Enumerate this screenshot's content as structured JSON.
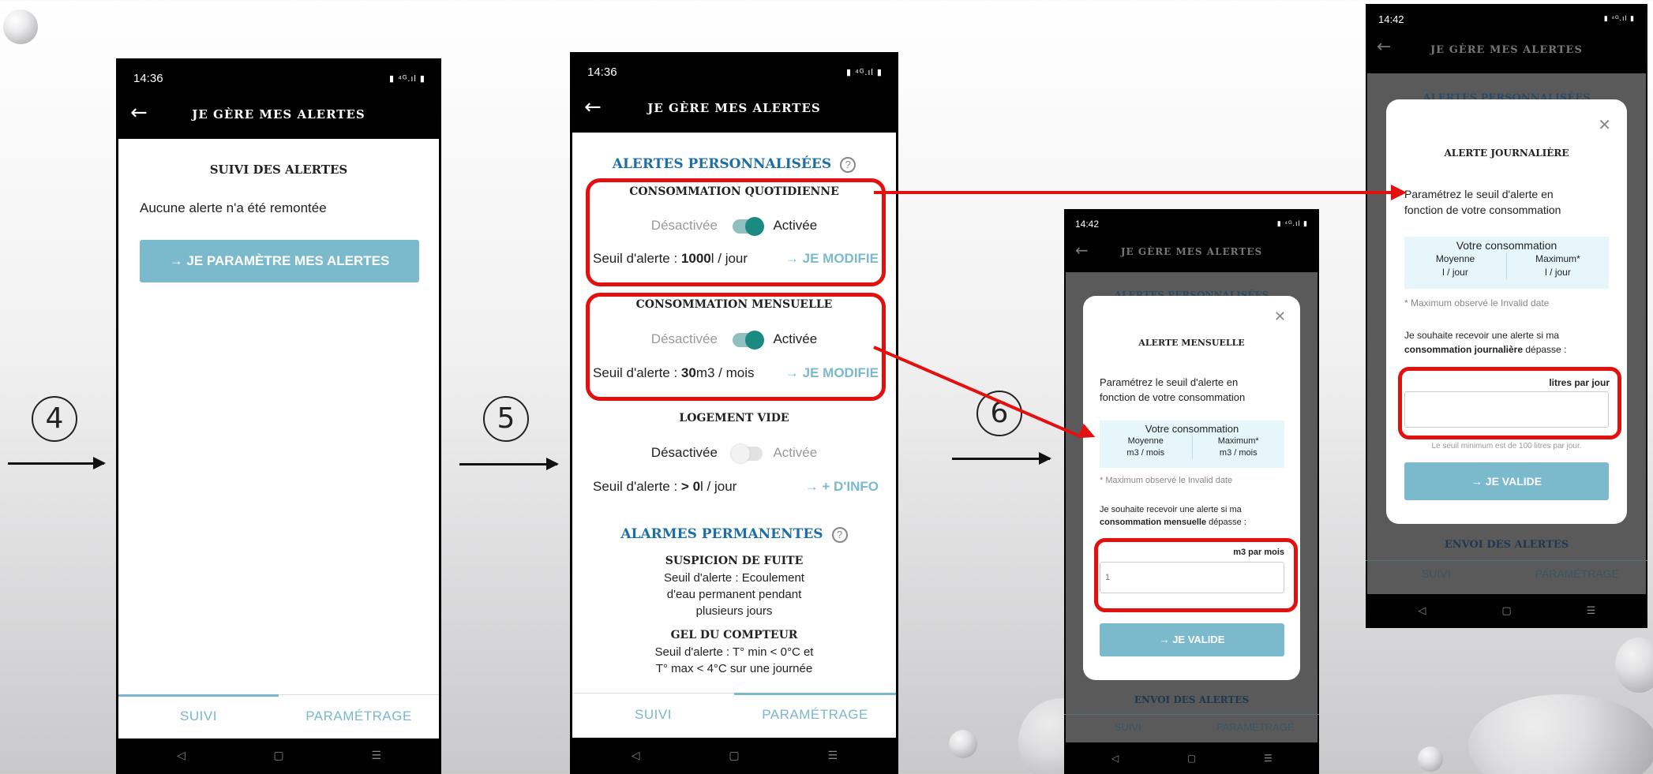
{
  "steps": {
    "s4": "4",
    "s5": "5",
    "s6": "6"
  },
  "status": {
    "time1": "14:36",
    "time2": "14:36",
    "time3": "14:42",
    "time4": "14:42",
    "icons": "▮ ⁴ᴳ.ıl ▮"
  },
  "header": {
    "title": "JE GÈRE MES ALERTES",
    "back": "←"
  },
  "screen4": {
    "heading": "SUIVI DES ALERTES",
    "empty": "Aucune alerte n'a été remontée",
    "button": "→ JE PARAMÈTRE MES ALERTES"
  },
  "tabs": {
    "suivi": "SUIVI",
    "param": "PARAMÉTRAGE"
  },
  "screen5": {
    "section1": "ALERTES PERSONNALISÉES",
    "help": "?",
    "daily": {
      "title": "CONSOMMATION QUOTIDIENNE",
      "off": "Désactivée",
      "on": "Activée",
      "prefix": "Seuil d'alerte : ",
      "value": "1000",
      "unit": "l / jour",
      "link": "→ JE MODIFIE"
    },
    "monthly": {
      "title": "CONSOMMATION MENSUELLE",
      "off": "Désactivée",
      "on": "Activée",
      "prefix": "Seuil d'alerte : ",
      "value": "30",
      "unit": "m3 / mois",
      "link": "→ JE MODIFIE"
    },
    "vacant": {
      "title": "LOGEMENT VIDE",
      "off": "Désactivée",
      "on": "Activée",
      "prefix": "Seuil d'alerte : ",
      "value": "> 0",
      "unit": "l / jour",
      "link": "→ + D'INFO"
    },
    "section2": "ALARMES PERMANENTES",
    "leak": {
      "title": "SUSPICION DE FUITE",
      "l1": "Seuil d'alerte : Ecoulement",
      "l2": "d'eau permanent pendant",
      "l3": "plusieurs jours"
    },
    "frost": {
      "title": "GEL DU COMPTEUR",
      "l1": "Seuil d'alerte : T° min < 0°C et",
      "l2": "T° max < 4°C sur une journée"
    }
  },
  "modal_monthly": {
    "bg_section": "ALERTES PERSONNALISÉES",
    "close": "✕",
    "title": "ALERTE MENSUELLE",
    "intro1": "Paramétrez le seuil d'alerte en",
    "intro2": "fonction de votre consommation",
    "cons_title": "Votre consommation",
    "avg_label": "Moyenne",
    "avg_unit": "m3 / mois",
    "max_label": "Maximum*",
    "max_unit": "m3 / mois",
    "footnote": "* Maximum observé le Invalid date",
    "wish1": "Je souhaite recevoir une alerte si ma",
    "wish2a": "consommation mensuelle",
    "wish2b": " dépasse :",
    "unit_label": "m3 par mois",
    "placeholder": "1",
    "button": "→ JE VALIDE",
    "bottom_title": "ENVOI DES ALERTES",
    "tab1": "SUIVI",
    "tab2": "PARAMÉTRAGE"
  },
  "modal_daily": {
    "bg_section": "ALERTES PERSONNALISÉES",
    "close": "✕",
    "title": "ALERTE JOURNALIÈRE",
    "intro1": "Paramétrez le seuil d'alerte en",
    "intro2": "fonction de votre consommation",
    "cons_title": "Votre consommation",
    "avg_label": "Moyenne",
    "avg_unit": "l / jour",
    "max_label": "Maximum*",
    "max_unit": "l / jour",
    "footnote": "* Maximum observé le Invalid date",
    "wish1": "Je souhaite recevoir une alerte si ma",
    "wish2a": "consommation journalière",
    "wish2b": " dépasse :",
    "unit_label": "litres par jour",
    "min_hint": "Le seuil minimum est de 100 litres par jour.",
    "button": "→ JE VALIDE",
    "bottom_title": "ENVOI DES ALERTES",
    "tab1": "SUIVI",
    "tab2": "PARAMÉTRAGE"
  },
  "nav": {
    "back": "◁",
    "home": "▢",
    "menu": "☰"
  }
}
